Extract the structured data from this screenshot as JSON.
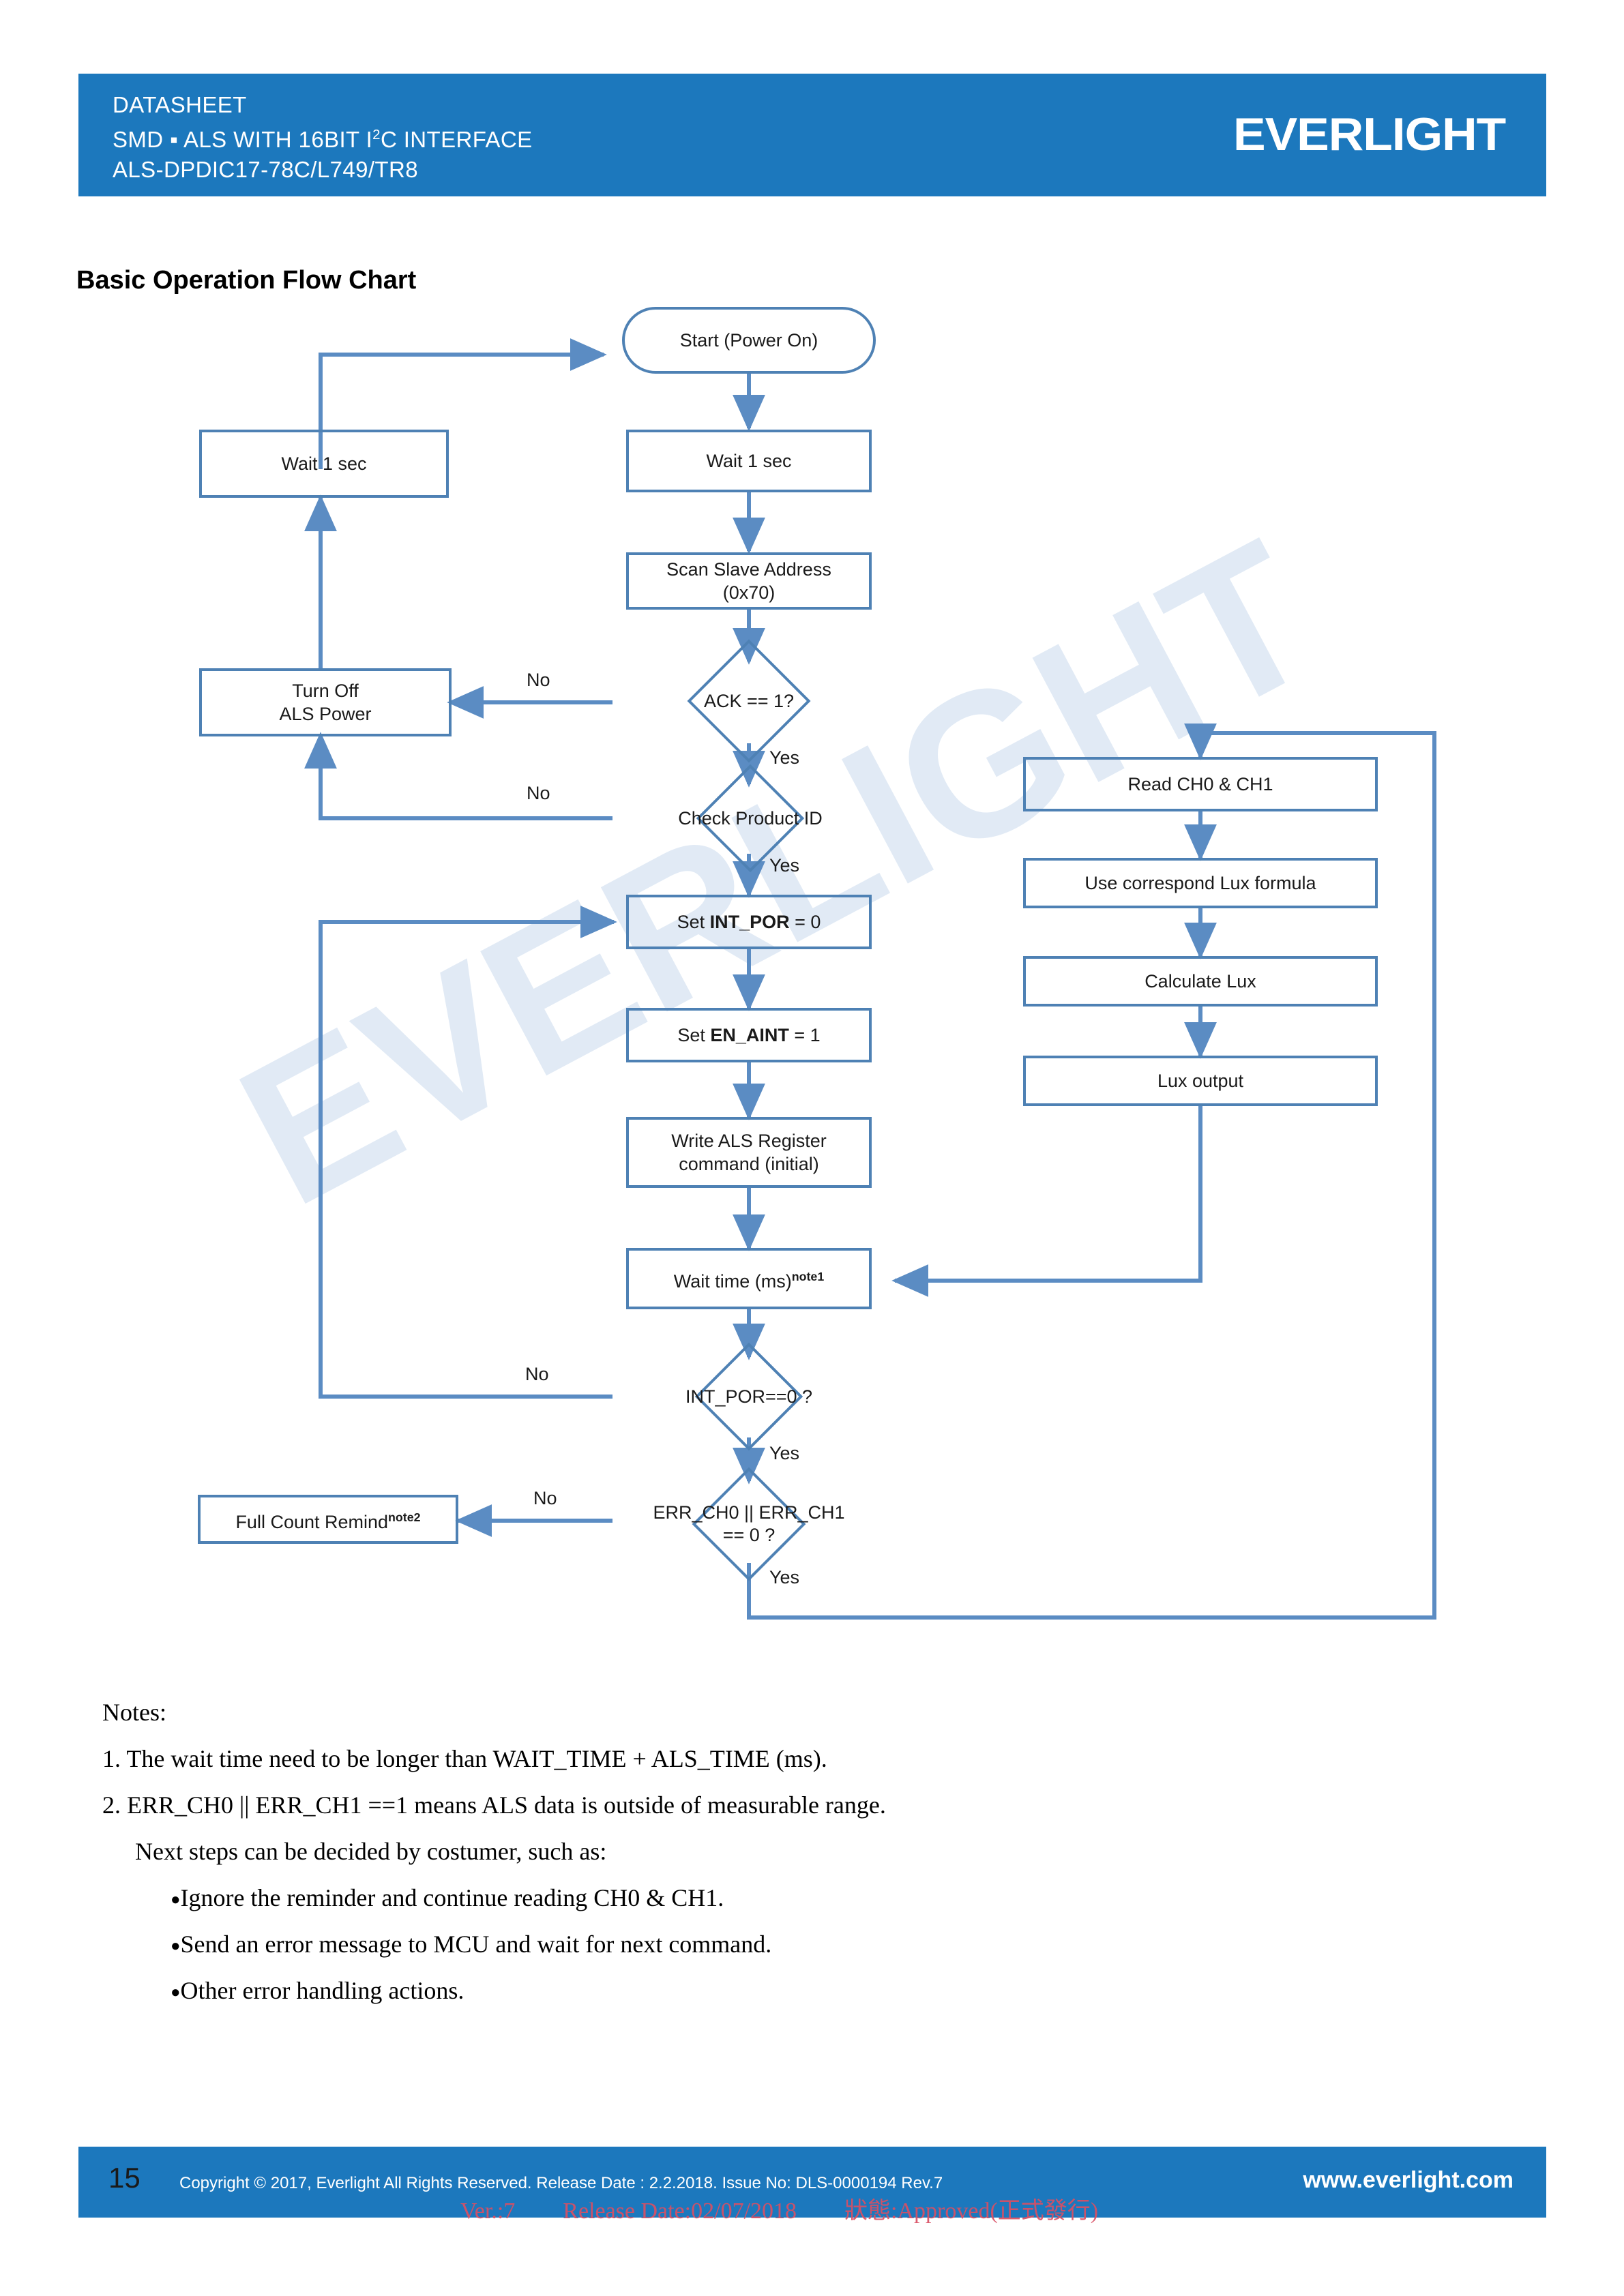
{
  "header": {
    "line1": "DATASHEET",
    "line2_pre": "SMD ▪ ALS WITH 16BIT I",
    "line2_sup": "2",
    "line2_post": "C INTERFACE",
    "line3": "ALS-DPDIC17-78C/L749/TR8",
    "logo": "EVERLIGHT",
    "bar_color": "#1c78bd"
  },
  "page_title": "Basic Operation Flow Chart",
  "watermark": "EVERLIGHT",
  "chart_data": {
    "type": "flowchart",
    "title": "Basic Operation Flow Chart",
    "accent_color": "#4e81b4",
    "nodes": [
      {
        "id": "start",
        "shape": "terminator",
        "label": "Start (Power On)"
      },
      {
        "id": "wait1_left",
        "shape": "process",
        "label": "Wait 1 sec"
      },
      {
        "id": "wait1_main",
        "shape": "process",
        "label": "Wait 1 sec"
      },
      {
        "id": "scan",
        "shape": "process",
        "label": "Scan Slave Address\n(0x70)"
      },
      {
        "id": "ack",
        "shape": "decision",
        "label": "ACK ==  1?"
      },
      {
        "id": "turnoff",
        "shape": "process",
        "label": "Turn Off\nALS Power"
      },
      {
        "id": "checkid",
        "shape": "decision",
        "label": "Check Product ID"
      },
      {
        "id": "set_intpor",
        "shape": "process",
        "label": "Set INT_POR = 0"
      },
      {
        "id": "set_enaint",
        "shape": "process",
        "label": "Set EN_AINT  = 1"
      },
      {
        "id": "write_als",
        "shape": "process",
        "label": "Write ALS Register\ncommand (initial)"
      },
      {
        "id": "wait_ms",
        "shape": "process",
        "label": "Wait time (ms)note1"
      },
      {
        "id": "intpor_q",
        "shape": "decision",
        "label": "INT_POR==0 ?"
      },
      {
        "id": "err_q",
        "shape": "decision",
        "label": "ERR_CH0 || ERR_CH1\n== 0 ?"
      },
      {
        "id": "fullcount",
        "shape": "process",
        "label": "Full Count Remindnote2"
      },
      {
        "id": "read_ch",
        "shape": "process",
        "label": "Read CH0 & CH1"
      },
      {
        "id": "lux_formula",
        "shape": "process",
        "label": "Use correspond  Lux formula"
      },
      {
        "id": "calc_lux",
        "shape": "process",
        "label": "Calculate Lux"
      },
      {
        "id": "lux_out",
        "shape": "process",
        "label": "Lux output"
      }
    ],
    "edges": [
      {
        "from": "wait1_left",
        "to": "start",
        "label": ""
      },
      {
        "from": "start",
        "to": "wait1_main",
        "label": ""
      },
      {
        "from": "wait1_main",
        "to": "scan",
        "label": ""
      },
      {
        "from": "scan",
        "to": "ack",
        "label": ""
      },
      {
        "from": "ack",
        "to": "turnoff",
        "label": "No"
      },
      {
        "from": "ack",
        "to": "checkid",
        "label": "Yes"
      },
      {
        "from": "turnoff",
        "to": "wait1_left",
        "label": ""
      },
      {
        "from": "checkid",
        "to": "turnoff",
        "label": "No"
      },
      {
        "from": "checkid",
        "to": "set_intpor",
        "label": "Yes"
      },
      {
        "from": "set_intpor",
        "to": "set_enaint",
        "label": ""
      },
      {
        "from": "set_enaint",
        "to": "write_als",
        "label": ""
      },
      {
        "from": "write_als",
        "to": "wait_ms",
        "label": ""
      },
      {
        "from": "wait_ms",
        "to": "intpor_q",
        "label": ""
      },
      {
        "from": "intpor_q",
        "to": "set_intpor",
        "label": "No"
      },
      {
        "from": "intpor_q",
        "to": "err_q",
        "label": "Yes"
      },
      {
        "from": "err_q",
        "to": "fullcount",
        "label": "No"
      },
      {
        "from": "err_q",
        "to": "read_ch",
        "label": "Yes"
      },
      {
        "from": "read_ch",
        "to": "lux_formula",
        "label": ""
      },
      {
        "from": "lux_formula",
        "to": "calc_lux",
        "label": ""
      },
      {
        "from": "calc_lux",
        "to": "lux_out",
        "label": ""
      },
      {
        "from": "lux_out",
        "to": "wait_ms",
        "label": ""
      }
    ],
    "edge_labels": [
      "No",
      "Yes",
      "No",
      "Yes",
      "No",
      "Yes",
      "No",
      "Yes"
    ]
  },
  "flow": {
    "start": "Start (Power On)",
    "wait1_left": "Wait 1 sec",
    "wait1_main": "Wait 1 sec",
    "scan_l1": "Scan Slave Address",
    "scan_l2": "(0x70)",
    "ack": "ACK ==  1?",
    "turnoff_l1": "Turn Off",
    "turnoff_l2": "ALS Power",
    "checkid": "Check Product ID",
    "set_intpor_pre": "Set ",
    "set_intpor_b": "INT_POR",
    "set_intpor_post": " = 0",
    "set_enaint_pre": "Set ",
    "set_enaint_b": "EN_AINT",
    "set_enaint_post": "  = 1",
    "write_l1": "Write ALS Register",
    "write_l2": "command (initial)",
    "wait_ms": "Wait time (ms)",
    "wait_ms_sup": "note1",
    "intpor_q": "INT_POR==0 ?",
    "err_q_l1": "ERR_CH0 || ERR_CH1",
    "err_q_l2": "== 0 ?",
    "fullcount": "Full Count Remind",
    "fullcount_sup": "note2",
    "read_ch": "Read CH0 & CH1",
    "lux_formula": "Use correspond  Lux formula",
    "calc_lux": "Calculate Lux",
    "lux_out": "Lux output",
    "lbl_no_ack": "No",
    "lbl_yes_ack": "Yes",
    "lbl_no_id": "No",
    "lbl_yes_id": "Yes",
    "lbl_no_intpor": "No",
    "lbl_yes_intpor": "Yes",
    "lbl_no_err": "No",
    "lbl_yes_err": "Yes"
  },
  "notes": {
    "heading": "Notes:",
    "n1": "1. The wait time need to be longer than WAIT_TIME + ALS_TIME (ms).",
    "n2": "2. ERR_CH0 || ERR_CH1 ==1 means ALS data is outside of measurable range.",
    "n2sub": "Next steps can be decided by costumer, such as:",
    "b1": "Ignore the reminder and continue reading CH0 & CH1.",
    "b2": "Send an error message to MCU and wait for next command.",
    "b3": "Other error handling actions."
  },
  "footer": {
    "page": "15",
    "copyright": "Copyright © 2017, Everlight All Rights Reserved. Release Date : 2.2.2018. Issue No: DLS-0000194 Rev.7",
    "url": "www.everlight.com",
    "stamp_ver": "Ver.:7",
    "stamp_release": "Release Date:02/07/2018",
    "stamp_status": "狀態:Approved(正式發行)",
    "bar_color": "#1c78bd",
    "stamp_color": "#d94f63"
  }
}
